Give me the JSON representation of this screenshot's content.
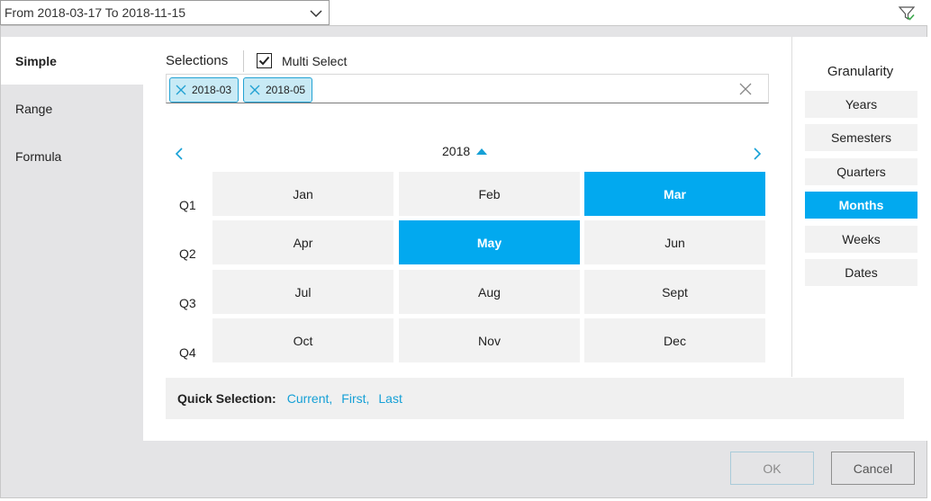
{
  "range_dropdown": {
    "text": "From 2018-03-17 To 2018-11-15"
  },
  "nav": {
    "items": [
      {
        "label": "Simple"
      },
      {
        "label": "Range"
      },
      {
        "label": "Formula"
      }
    ]
  },
  "selections": {
    "title": "Selections",
    "multi_select_label": "Multi Select",
    "multi_select_checked": true,
    "chips": [
      {
        "label": "2018-03"
      },
      {
        "label": "2018-05"
      }
    ]
  },
  "calendar": {
    "year": "2018",
    "quarters": [
      {
        "label": "Q1",
        "months": [
          "Jan",
          "Feb",
          "Mar"
        ]
      },
      {
        "label": "Q2",
        "months": [
          "Apr",
          "May",
          "Jun"
        ]
      },
      {
        "label": "Q3",
        "months": [
          "Jul",
          "Aug",
          "Sept"
        ]
      },
      {
        "label": "Q4",
        "months": [
          "Oct",
          "Nov",
          "Dec"
        ]
      }
    ],
    "selected_months": [
      "Mar",
      "May"
    ]
  },
  "quick_selection": {
    "label": "Quick Selection:",
    "links": [
      {
        "label": "Current"
      },
      {
        "label": "First"
      },
      {
        "label": "Last"
      }
    ],
    "separator": ","
  },
  "granularity": {
    "title": "Granularity",
    "options": [
      {
        "label": "Years"
      },
      {
        "label": "Semesters"
      },
      {
        "label": "Quarters"
      },
      {
        "label": "Months"
      },
      {
        "label": "Weeks"
      },
      {
        "label": "Dates"
      }
    ],
    "active": "Months"
  },
  "buttons": {
    "ok": "OK",
    "cancel": "Cancel"
  },
  "colors": {
    "accent": "#02a9ef",
    "chip_bg": "#c8eaf5",
    "link": "#15a0d6",
    "dialog_bg": "#e4e4e6"
  }
}
